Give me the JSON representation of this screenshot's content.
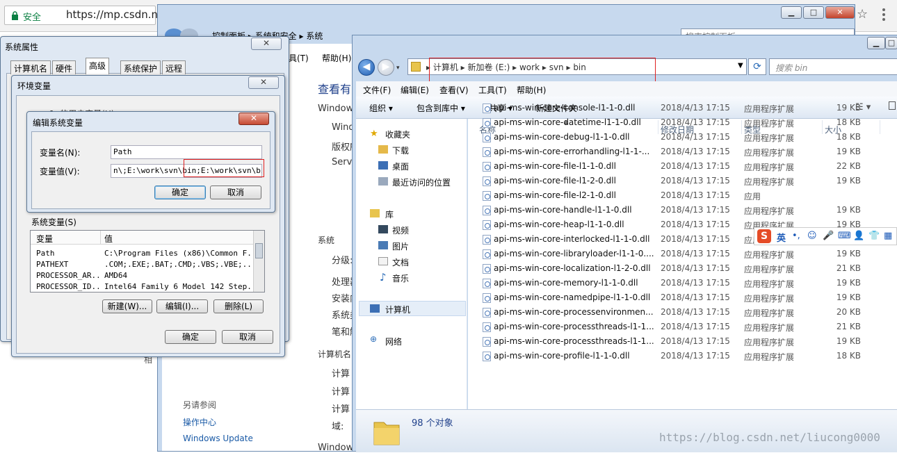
{
  "browser": {
    "secure_label": "安全",
    "url": "https://mp.csdn.net/"
  },
  "control_panel": {
    "breadcrumb": [
      "控制面板",
      "系统和安全",
      "系统"
    ],
    "search_placeholder": "搜索控制面板",
    "menu": [
      "具(T)",
      "帮助(H)"
    ],
    "heading": "查看有",
    "texts": [
      "Windows",
      "Wind",
      "版权所",
      "Servi",
      "系统",
      "分级:",
      "处理器",
      "安装内",
      "系统类",
      "笔和触",
      "计算机名",
      "计算",
      "计算",
      "计算",
      "域:",
      "Windows"
    ],
    "see_also": "另请参阅",
    "links": [
      "操作中心",
      "Windows Update"
    ]
  },
  "sysprops": {
    "title": "系统属性",
    "tabs": [
      "计算机名",
      "硬件",
      "高级",
      "系统保护",
      "远程"
    ],
    "bg_fragment": "相"
  },
  "envvars": {
    "title": "环境变量",
    "user_label_fragment": "1. 的用户变量(U)",
    "system_label": "系统变量(S)",
    "columns": [
      "变量",
      "值"
    ],
    "rows": [
      {
        "name": "Path",
        "value": "C:\\Program Files (x86)\\Common F..."
      },
      {
        "name": "PATHEXT",
        "value": ".COM;.EXE;.BAT;.CMD;.VBS;.VBE;...."
      },
      {
        "name": "PROCESSOR_AR...",
        "value": "AMD64"
      },
      {
        "name": "PROCESSOR_ID...",
        "value": "Intel64 Family 6 Model 142 Step..."
      }
    ],
    "new_btn": "新建(W)...",
    "edit_btn": "编辑(I)...",
    "delete_btn": "删除(L)",
    "ok_btn": "确定",
    "cancel_btn": "取消"
  },
  "editvar": {
    "title": "编辑系统变量",
    "name_label": "变量名(N):",
    "name_value": "Path",
    "value_label": "变量值(V):",
    "value_value": "n\\;E:\\work\\svn\\bin;E:\\work\\svn\\bin;",
    "ok_btn": "确定",
    "cancel_btn": "取消"
  },
  "explorer": {
    "address": [
      "计算机",
      "新加卷 (E:)",
      "work",
      "svn",
      "bin"
    ],
    "search_placeholder": "搜索 bin",
    "menu": [
      "文件(F)",
      "编辑(E)",
      "查看(V)",
      "工具(T)",
      "帮助(H)"
    ],
    "toolbar": [
      "组织 ▾",
      "包含到库中 ▾",
      "共享 ▾",
      "新建文件夹"
    ],
    "nav": {
      "favorites": "收藏夹",
      "fav_items": [
        "下载",
        "桌面",
        "最近访问的位置"
      ],
      "library": "库",
      "lib_items": [
        "视频",
        "图片",
        "文档",
        "音乐"
      ],
      "computer": "计算机",
      "network": "网络"
    },
    "columns": [
      "名称",
      "修改日期",
      "类型",
      "大小"
    ],
    "files": [
      {
        "name": "api-ms-win-core-console-l1-1-0.dll",
        "date": "2018/4/13 17:15",
        "type": "应用程序扩展",
        "size": "19 KB"
      },
      {
        "name": "api-ms-win-core-datetime-l1-1-0.dll",
        "date": "2018/4/13 17:15",
        "type": "应用程序扩展",
        "size": "18 KB"
      },
      {
        "name": "api-ms-win-core-debug-l1-1-0.dll",
        "date": "2018/4/13 17:15",
        "type": "应用程序扩展",
        "size": "18 KB"
      },
      {
        "name": "api-ms-win-core-errorhandling-l1-1-...",
        "date": "2018/4/13 17:15",
        "type": "应用程序扩展",
        "size": "19 KB"
      },
      {
        "name": "api-ms-win-core-file-l1-1-0.dll",
        "date": "2018/4/13 17:15",
        "type": "应用程序扩展",
        "size": "22 KB"
      },
      {
        "name": "api-ms-win-core-file-l1-2-0.dll",
        "date": "2018/4/13 17:15",
        "type": "应用程序扩展",
        "size": "19 KB"
      },
      {
        "name": "api-ms-win-core-file-l2-1-0.dll",
        "date": "2018/4/13 17:15",
        "type": "应用",
        "size": ""
      },
      {
        "name": "api-ms-win-core-handle-l1-1-0.dll",
        "date": "2018/4/13 17:15",
        "type": "应用程序扩展",
        "size": "19 KB"
      },
      {
        "name": "api-ms-win-core-heap-l1-1-0.dll",
        "date": "2018/4/13 17:15",
        "type": "应用程序扩展",
        "size": "19 KB"
      },
      {
        "name": "api-ms-win-core-interlocked-l1-1-0.dll",
        "date": "2018/4/13 17:15",
        "type": "应用程序扩展",
        "size": "19 KB"
      },
      {
        "name": "api-ms-win-core-libraryloader-l1-1-0....",
        "date": "2018/4/13 17:15",
        "type": "应用程序扩展",
        "size": "19 KB"
      },
      {
        "name": "api-ms-win-core-localization-l1-2-0.dll",
        "date": "2018/4/13 17:15",
        "type": "应用程序扩展",
        "size": "21 KB"
      },
      {
        "name": "api-ms-win-core-memory-l1-1-0.dll",
        "date": "2018/4/13 17:15",
        "type": "应用程序扩展",
        "size": "19 KB"
      },
      {
        "name": "api-ms-win-core-namedpipe-l1-1-0.dll",
        "date": "2018/4/13 17:15",
        "type": "应用程序扩展",
        "size": "19 KB"
      },
      {
        "name": "api-ms-win-core-processenvironmen...",
        "date": "2018/4/13 17:15",
        "type": "应用程序扩展",
        "size": "20 KB"
      },
      {
        "name": "api-ms-win-core-processthreads-l1-1...",
        "date": "2018/4/13 17:15",
        "type": "应用程序扩展",
        "size": "21 KB"
      },
      {
        "name": "api-ms-win-core-processthreads-l1-1...",
        "date": "2018/4/13 17:15",
        "type": "应用程序扩展",
        "size": "19 KB"
      },
      {
        "name": "api-ms-win-core-profile-l1-1-0.dll",
        "date": "2018/4/13 17:15",
        "type": "应用程序扩展",
        "size": "18 KB"
      }
    ],
    "status": "98 个对象"
  },
  "ime": {
    "mode": "英"
  },
  "watermark": "https://blog.csdn.net/liucong0000"
}
